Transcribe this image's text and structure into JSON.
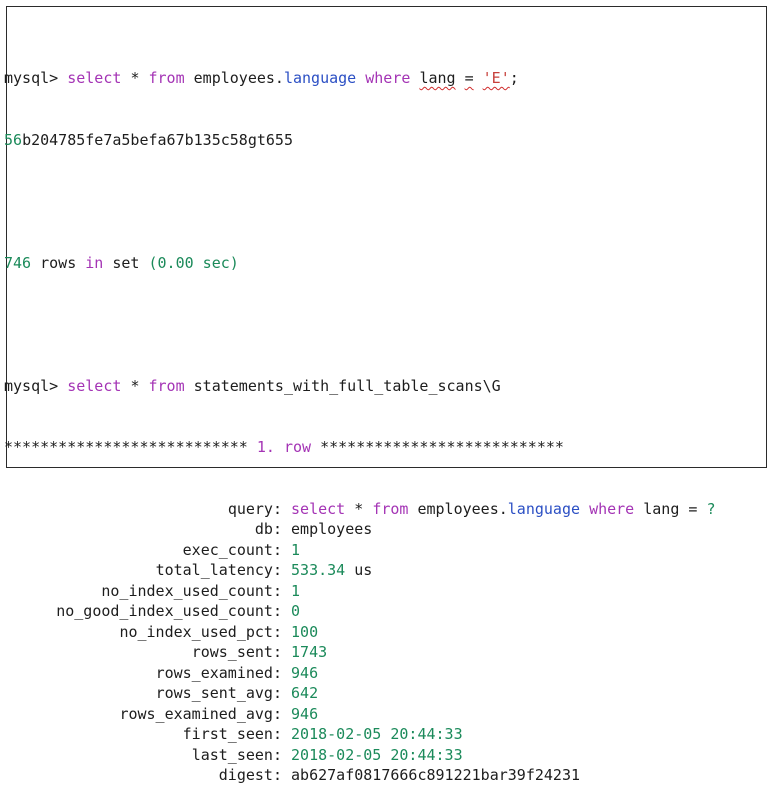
{
  "terminal": {
    "prompt": "mysql>",
    "cmd1": {
      "select": "select",
      "star": "*",
      "from": "from",
      "schema": "employees.",
      "table": "language",
      "where": "where",
      "col": "lang",
      "eq": "=",
      "literal": "'E'",
      "semicolon": ";"
    },
    "hash_prefix": "56",
    "hash_rest": "b204785fe7a5befa67b135c58gt655",
    "rows_count": "746",
    "rows_text": "rows",
    "rows_in": "in",
    "rows_set": "set",
    "rows_time": "(0.00 sec)",
    "cmd2": {
      "select": "select",
      "star": "*",
      "from": "from",
      "view": "statements_with_full_table_scans\\G"
    },
    "row_header_left": "***************************",
    "row_header_mid": "1. row",
    "row_header_right": "***************************",
    "fields": [
      {
        "name": "query:",
        "value": "select * from employees.language where lang = ?"
      },
      {
        "name": "db:",
        "value": "employees"
      },
      {
        "name": "exec_count:",
        "value": "1"
      },
      {
        "name": "total_latency:",
        "value": "533.34 us"
      },
      {
        "name": "no_index_used_count:",
        "value": "1"
      },
      {
        "name": "no_good_index_used_count:",
        "value": "0"
      },
      {
        "name": "no_index_used_pct:",
        "value": "100"
      },
      {
        "name": "rows_sent:",
        "value": "1743"
      },
      {
        "name": "rows_examined:",
        "value": "946"
      },
      {
        "name": "rows_sent_avg:",
        "value": "642"
      },
      {
        "name": "rows_examined_avg:",
        "value": "946"
      },
      {
        "name": "first_seen:",
        "value": "2018-02-05 20:44:33"
      },
      {
        "name": "last_seen:",
        "value": "2018-02-05 20:44:33"
      },
      {
        "name": "digest:",
        "value": "ab627af0817666c891221bar39f24231"
      }
    ]
  }
}
